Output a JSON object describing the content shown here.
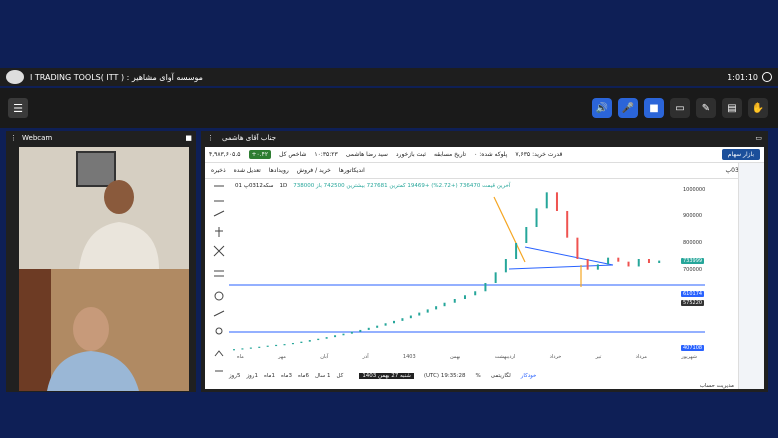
{
  "titlebar": {
    "title": "I TRADING TOOLS( ITT ) : موسسه آوای مشاهیر",
    "time": "1:01:10"
  },
  "webcam": {
    "label": "Webcam"
  },
  "share": {
    "presenter": "جناب آقای هاشمی"
  },
  "app": {
    "market_button": "بازار سهام",
    "buy_power": "قدرت خرید: ۷,۶۳۵",
    "portfolio": "پلوکه شده: ۰",
    "tab_history": "تاریخ مسابقه",
    "tab_record": "ثبت بازخورد",
    "index_label": "شاخص کل",
    "index_change": "+۰.۴۲",
    "index_value": "۴,۹۸۳,۶۰۵.۵",
    "time_value": "۱۰:۳۵:۲۳",
    "user": "سید رضا هاشمی",
    "symbol": "سکه0312پ",
    "toolbar_indicators": "اندیکاتورها",
    "toolbar_buysell": "خرید / فروش",
    "toolbar_events": "رویدادها",
    "toolbar_adjust": "تعدیل شده",
    "save_label": "ذخیره",
    "interval": "1D",
    "ohlc_title": "سکه0312پ 01",
    "quote_line": "آخرین قیمت 736470 (+2.72%) +19469 کمترین 727681 بیشترین 742500 باز 738000",
    "bottom_date": "شنبه 27 بهمن 1403",
    "utc_time": "(UTC) 19:35:28",
    "log_toggle": "لگاریتمی",
    "auto_toggle": "خودکار",
    "percent_toggle": "%",
    "ranges": [
      "کل",
      "1 سال",
      "6ماه",
      "3ماه",
      "1ماه",
      "1روز",
      "5روز"
    ],
    "account_menu": "مدیریت حساب"
  },
  "chart_data": {
    "type": "candlestick",
    "x_labels": [
      "ماه",
      "مهر",
      "آبان",
      "آذر",
      "1403",
      "بهمن",
      "اردیبهشت",
      "خرداد",
      "تیر",
      "مرداد",
      "شهریور"
    ],
    "y_ticks": [
      1000000,
      900000,
      800000,
      700000,
      600000
    ],
    "price_labels": [
      {
        "value": "733999",
        "color": "#26a69a"
      },
      {
        "value": "610174",
        "color": "#2962ff"
      },
      {
        "value": "575220",
        "color": "#333333"
      },
      {
        "value": "407108",
        "color": "#2962ff"
      }
    ],
    "series": [
      {
        "values": [
          402000,
          405000,
          408000,
          411000,
          415000,
          418000,
          421000,
          425000,
          430000,
          436000,
          441000,
          447000,
          454000,
          460000,
          467000,
          474000,
          482000,
          490000,
          499000,
          508000,
          518000,
          528000,
          539000,
          551000,
          563000,
          576000,
          590000,
          604000,
          619000,
          650000,
          690000,
          740000,
          800000,
          860000,
          930000,
          990000,
          920000,
          820000,
          740000,
          700000,
          720000,
          745000,
          730000,
          712000,
          740000,
          725000,
          733999
        ]
      }
    ],
    "ylim": [
      380000,
      1040000
    ]
  }
}
